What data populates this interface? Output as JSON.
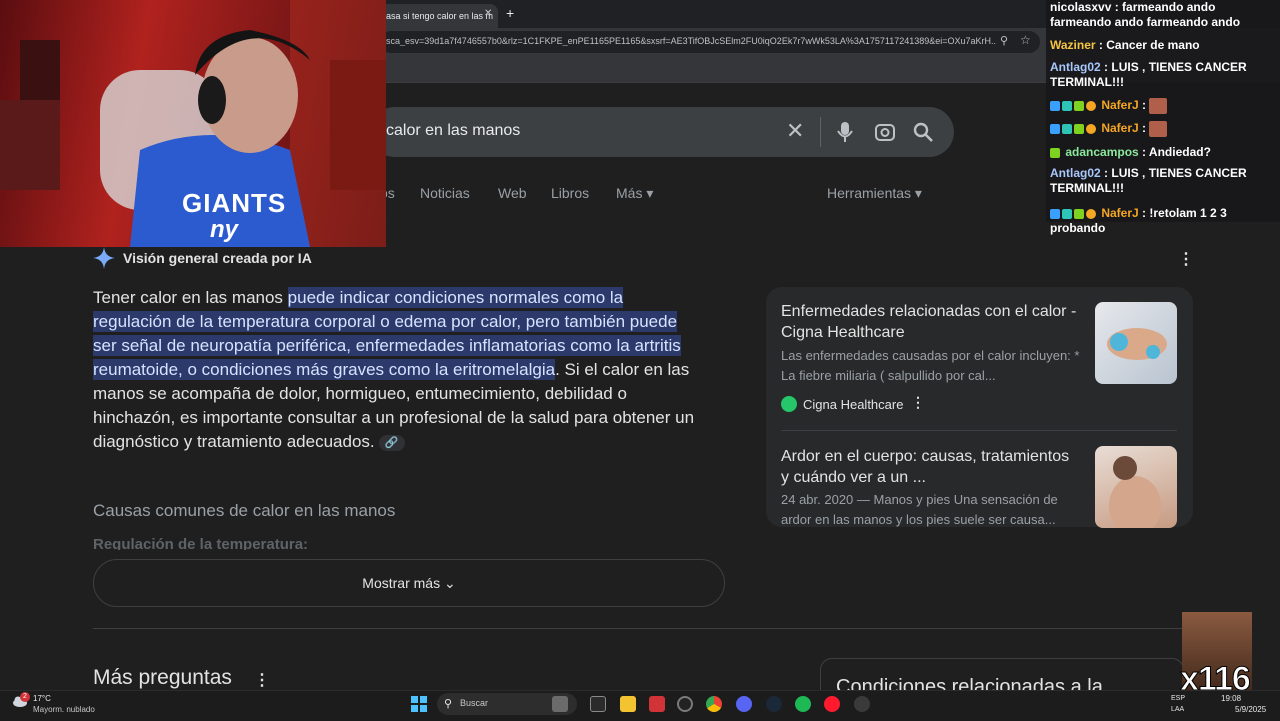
{
  "browser": {
    "tab_title": "asa si tengo calor en las m",
    "new_tab": "+",
    "url": "sca_esv=39d1a7f4746557b0&rlz=1C1FKPE_enPE1165PE1165&sxsrf=AE3TifOBJcSElm2FU0iqO2Ek7r7wWk53LA%3A1757117241389&ei=OXu7aKrH..."
  },
  "search": {
    "query": "calor en las manos",
    "tabs": [
      "os",
      "Noticias",
      "Web",
      "Libros",
      "Más ▾"
    ],
    "tools": "Herramientas ▾"
  },
  "ai_overview": {
    "title": "Visión general creada por IA",
    "text_plain_start": "Tener calor en las manos ",
    "text_highlight": "puede indicar condiciones normales como la regulación de la temperatura corporal o edema por calor, pero también puede ser señal de neuropatía periférica, enfermedades inflamatorias como la artritis reumatoide, o condiciones más graves como la eritromelalgia",
    "text_plain_end": ". Si el calor en las manos se acompaña de dolor, hormigueo, entumecimiento, debilidad o hinchazón, es importante consultar a un profesional de la salud para obtener un diagnóstico y tratamiento adecuados.",
    "section_heading": "Causas comunes de calor en las manos",
    "subheading": "Regulación de la temperatura:",
    "show_more": "Mostrar más"
  },
  "more_questions": "Más preguntas",
  "related_conditions": "Condiciones relacionadas a la",
  "side_cards": [
    {
      "title": "Enfermedades relacionadas con el calor - Cigna Healthcare",
      "snippet": "Las enfermedades causadas por el calor incluyen: * La fiebre miliaria ( salpullido por cal...",
      "source": "Cigna Healthcare"
    },
    {
      "title": "Ardor en el cuerpo: causas, tratamientos y cuándo ver a un ...",
      "snippet": "24 abr. 2020 — Manos y pies Una sensación de ardor en las manos y los pies suele ser causa..."
    }
  ],
  "webcam": {
    "shirt_text1": "GIANTS",
    "shirt_text2": "ny"
  },
  "chat": [
    {
      "user": "nicolasxvv",
      "color": "#ffffff",
      "msg": "farmeando ando farmeando ando farmeando ando"
    },
    {
      "user": "Waziner",
      "color": "#f5c542",
      "msg": "Cancer de mano"
    },
    {
      "user": "Antlag02",
      "color": "#a8c7fa",
      "msg": "LUIS , TIENES CANCER TERMINAL!!!"
    },
    {
      "user": "NaferJ",
      "color": "#f5a623",
      "msg": ""
    },
    {
      "user": "NaferJ",
      "color": "#f5a623",
      "msg": ""
    },
    {
      "user": "adancampos",
      "color": "#8ce99a",
      "msg": "Andiedad?"
    },
    {
      "user": "Antlag02",
      "color": "#a8c7fa",
      "msg": "LUIS , TIENES CANCER TERMINAL!!!"
    },
    {
      "user": "NaferJ",
      "color": "#f5a623",
      "msg": "!retolam 1 2 3 probando"
    }
  ],
  "meme_text": "x116",
  "taskbar": {
    "weather_badge": "2",
    "temp": "17°C",
    "weather": "Mayorm. nublado",
    "search": "Buscar",
    "lang1": "ESP",
    "lang2": "LAA",
    "time": "19:08",
    "date": "5/9/2025"
  },
  "colors": {
    "highlight": "#2b3a6b",
    "background": "#1f1f1f",
    "card": "#28292a"
  }
}
